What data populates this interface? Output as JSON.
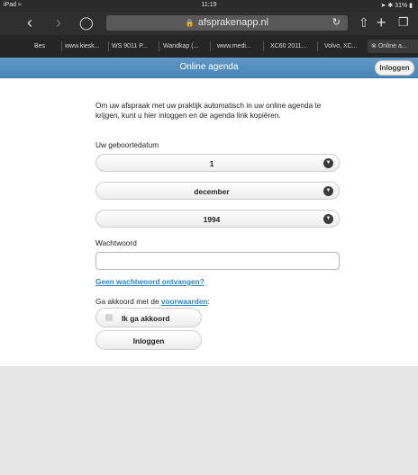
{
  "status": {
    "device": "iPad",
    "wifi": "wifi-icon",
    "time": "11:19",
    "battery": "31%"
  },
  "browser": {
    "url": "afsprakenapp.nl",
    "tabs": [
      "Bes",
      "www.kiesk...",
      "WS 9011 P...",
      "Wandkap (...",
      "www.medi...",
      "XC60 2011...",
      "Volvo, XC...",
      "Online a..."
    ]
  },
  "header": {
    "title": "Online agenda",
    "login_label": "Inloggen"
  },
  "form": {
    "intro": "Om uw afspraak met uw praktijk automatisch in uw online agenda te krijgen, kunt u hier inloggen en de agenda link kopiëren.",
    "birthdate_label": "Uw geboortedatum",
    "day": "1",
    "month": "december",
    "year": "1994",
    "password_label": "Wachtwoord",
    "password_value": "",
    "no_password_link": "Geen wachtwoord ontvangen?",
    "terms_prefix": "Ga akkoord met de ",
    "terms_link": "voorwaarden",
    "terms_suffix": ":",
    "agree_label": "Ik ga akkoord",
    "submit_label": "Inloggen"
  },
  "colors": {
    "header_blue": "#4f8bbd",
    "link_blue": "#2b86c7"
  }
}
